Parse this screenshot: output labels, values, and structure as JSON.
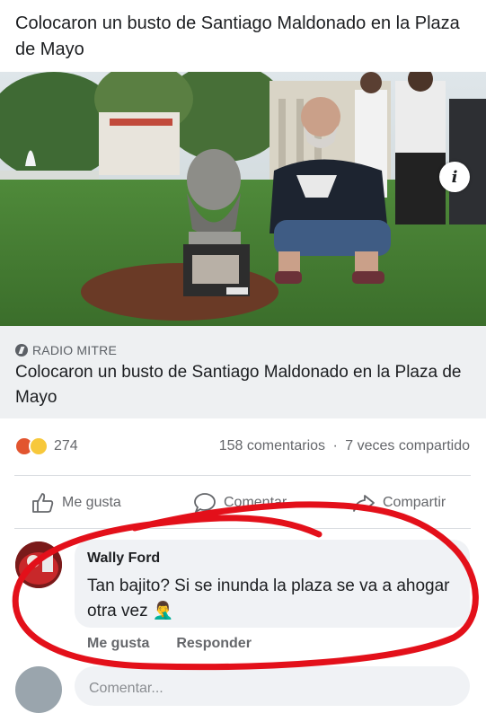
{
  "post": {
    "text": "Colocaron un busto de Santiago Maldonado en la Plaza de Mayo"
  },
  "link_preview": {
    "source": "RADIO MITRE",
    "title": "Colocaron un busto de Santiago Maldonado en la Plaza de Mayo",
    "image_description_icon": "info-icon"
  },
  "engagement": {
    "reaction_icons": [
      "angry-reaction-icon",
      "haha-reaction-icon"
    ],
    "reaction_count": "274",
    "comments": "158 comentarios",
    "separator": "·",
    "shares": "7 veces compartido"
  },
  "actions": {
    "like": "Me gusta",
    "comment": "Comentar",
    "share": "Compartir"
  },
  "comment": {
    "author": "Wally Ford",
    "text": "Tan bajito? Si se inunda la plaza se va a ahogar otra vez 🤦‍♂️",
    "like": "Me gusta",
    "reply": "Responder"
  },
  "composer": {
    "placeholder": "Comentar..."
  },
  "colors": {
    "annotation": "#e3101a",
    "text": "#1c1e21",
    "muted": "#65676b",
    "bubble": "#f0f2f5"
  }
}
